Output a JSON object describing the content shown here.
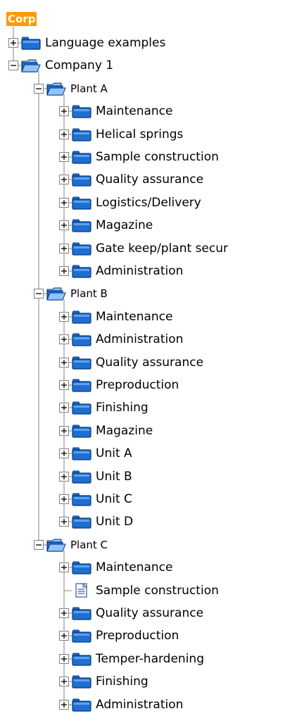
{
  "tree": {
    "root_label": "Corp",
    "nodes": [
      {
        "label": "Language examples",
        "level": 0,
        "toggle": "plus",
        "icon": "folder-closed-icon"
      },
      {
        "label": "Company 1",
        "level": 0,
        "toggle": "minus",
        "icon": "folder-open-icon"
      },
      {
        "label": "Plant A",
        "level": 1,
        "toggle": "minus",
        "icon": "folder-open-icon"
      },
      {
        "label": "Maintenance",
        "level": 2,
        "toggle": "plus",
        "icon": "folder-closed-icon"
      },
      {
        "label": "Helical springs",
        "level": 2,
        "toggle": "plus",
        "icon": "folder-closed-icon"
      },
      {
        "label": "Sample construction",
        "level": 2,
        "toggle": "plus",
        "icon": "folder-closed-icon"
      },
      {
        "label": "Quality assurance",
        "level": 2,
        "toggle": "plus",
        "icon": "folder-closed-icon"
      },
      {
        "label": "Logistics/Delivery",
        "level": 2,
        "toggle": "plus",
        "icon": "folder-closed-icon"
      },
      {
        "label": "Magazine",
        "level": 2,
        "toggle": "plus",
        "icon": "folder-closed-icon"
      },
      {
        "label": "Gate keep/plant secur",
        "level": 2,
        "toggle": "plus",
        "icon": "folder-closed-icon"
      },
      {
        "label": "Administration",
        "level": 2,
        "toggle": "plus",
        "icon": "folder-closed-icon"
      },
      {
        "label": "Plant B",
        "level": 1,
        "toggle": "minus",
        "icon": "folder-open-icon"
      },
      {
        "label": "Maintenance",
        "level": 2,
        "toggle": "plus",
        "icon": "folder-closed-icon"
      },
      {
        "label": "Administration",
        "level": 2,
        "toggle": "plus",
        "icon": "folder-closed-icon"
      },
      {
        "label": "Quality assurance",
        "level": 2,
        "toggle": "plus",
        "icon": "folder-closed-icon"
      },
      {
        "label": "Preproduction",
        "level": 2,
        "toggle": "plus",
        "icon": "folder-closed-icon"
      },
      {
        "label": "Finishing",
        "level": 2,
        "toggle": "plus",
        "icon": "folder-closed-icon"
      },
      {
        "label": "Magazine",
        "level": 2,
        "toggle": "plus",
        "icon": "folder-closed-icon"
      },
      {
        "label": "Unit A",
        "level": 2,
        "toggle": "plus",
        "icon": "folder-closed-icon"
      },
      {
        "label": "Unit B",
        "level": 2,
        "toggle": "plus",
        "icon": "folder-closed-icon"
      },
      {
        "label": "Unit C",
        "level": 2,
        "toggle": "plus",
        "icon": "folder-closed-icon"
      },
      {
        "label": "Unit D",
        "level": 2,
        "toggle": "plus",
        "icon": "folder-closed-icon"
      },
      {
        "label": "Plant C",
        "level": 1,
        "toggle": "minus",
        "icon": "folder-open-icon"
      },
      {
        "label": "Maintenance",
        "level": 2,
        "toggle": "plus",
        "icon": "folder-closed-icon"
      },
      {
        "label": "Sample construction",
        "level": 2,
        "toggle": "none",
        "icon": "document-icon"
      },
      {
        "label": "Quality assurance",
        "level": 2,
        "toggle": "plus",
        "icon": "folder-closed-icon"
      },
      {
        "label": "Preproduction",
        "level": 2,
        "toggle": "plus",
        "icon": "folder-closed-icon"
      },
      {
        "label": "Temper-hardening",
        "level": 2,
        "toggle": "plus",
        "icon": "folder-closed-icon"
      },
      {
        "label": "Finishing",
        "level": 2,
        "toggle": "plus",
        "icon": "folder-closed-icon"
      },
      {
        "label": "Administration",
        "level": 2,
        "toggle": "plus",
        "icon": "folder-closed-icon"
      }
    ]
  },
  "colors": {
    "root_label_bg": "#ff9900",
    "root_label_text": "#ffffff",
    "tree_line": "#808080",
    "folder_blue": "#1f6fd1",
    "folder_dark": "#003a7a",
    "folder_light": "#8fc2ff"
  }
}
